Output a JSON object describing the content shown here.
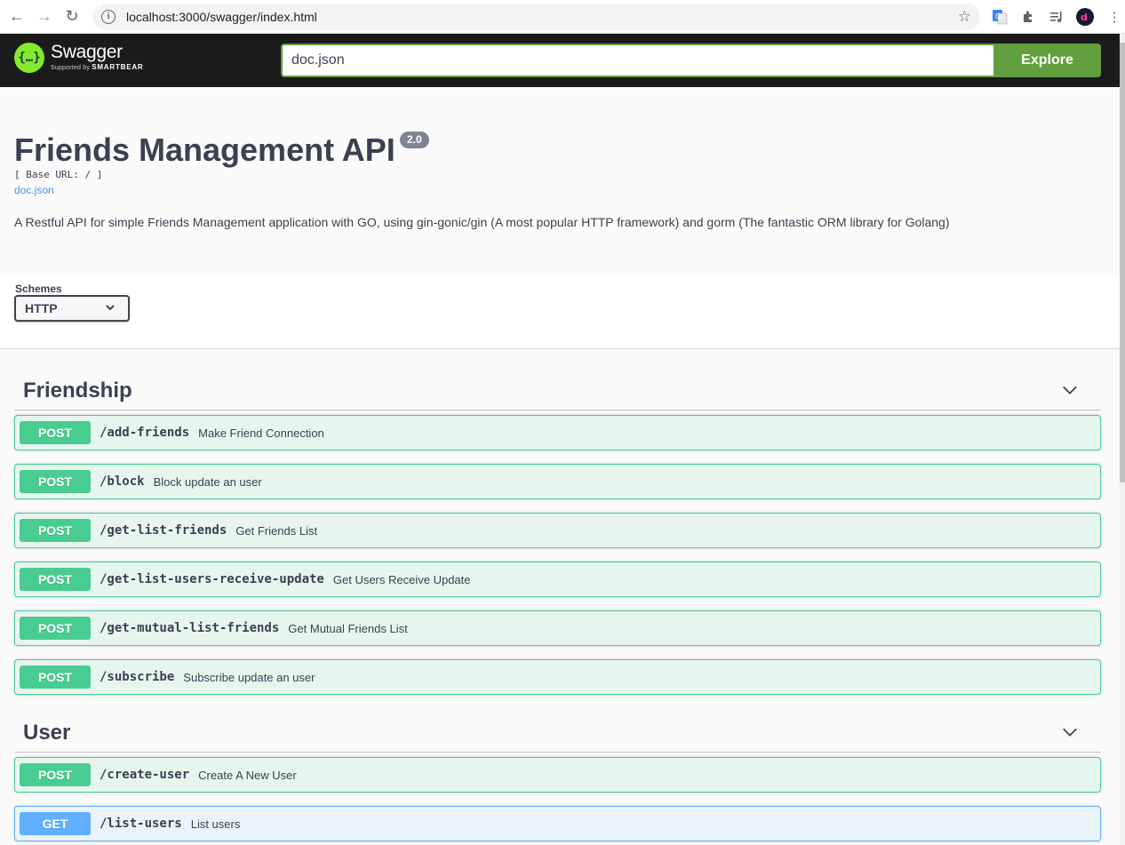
{
  "browser": {
    "url": "localhost:3000/swagger/index.html"
  },
  "topbar": {
    "logo_title": "Swagger",
    "logo_supported": "Supported by",
    "logo_brand": "SMARTBEAR",
    "url_value": "doc.json",
    "explore_label": "Explore"
  },
  "info": {
    "title": "Friends Management API",
    "version": "2.0",
    "base_url": "[ Base URL: / ]",
    "doc_link": "doc.json",
    "description": "A Restful API for simple Friends Management application with GO, using gin-gonic/gin (A most popular HTTP framework) and gorm (The fantastic ORM library for Golang)"
  },
  "schemes": {
    "label": "Schemes",
    "selected": "HTTP"
  },
  "tags": [
    {
      "name": "Friendship",
      "operations": [
        {
          "method": "POST",
          "path": "/add-friends",
          "summary": "Make Friend Connection"
        },
        {
          "method": "POST",
          "path": "/block",
          "summary": "Block update an user"
        },
        {
          "method": "POST",
          "path": "/get-list-friends",
          "summary": "Get Friends List"
        },
        {
          "method": "POST",
          "path": "/get-list-users-receive-update",
          "summary": "Get Users Receive Update"
        },
        {
          "method": "POST",
          "path": "/get-mutual-list-friends",
          "summary": "Get Mutual Friends List"
        },
        {
          "method": "POST",
          "path": "/subscribe",
          "summary": "Subscribe update an user"
        }
      ]
    },
    {
      "name": "User",
      "operations": [
        {
          "method": "POST",
          "path": "/create-user",
          "summary": "Create A New User"
        },
        {
          "method": "GET",
          "path": "/list-users",
          "summary": "List users"
        }
      ]
    }
  ],
  "colors": {
    "post": "#49cc90",
    "get": "#61affe",
    "swagger_green": "#62a03f",
    "topbar": "#1b1b1b"
  }
}
